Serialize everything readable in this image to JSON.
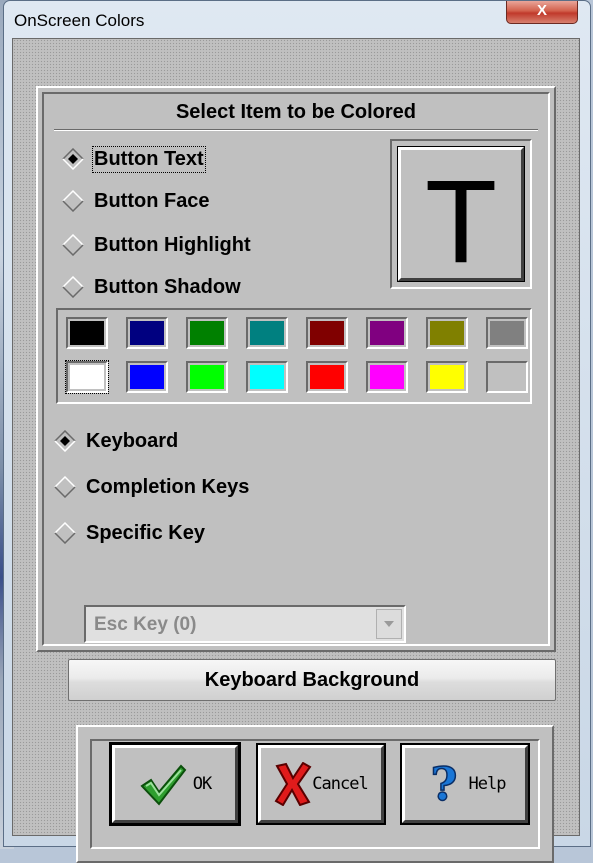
{
  "window": {
    "title": "OnScreen Colors",
    "close_glyph": "X"
  },
  "select_section": {
    "title": "Select Item to be Colored",
    "items": [
      {
        "label": "Button Text",
        "selected": true
      },
      {
        "label": "Button Face",
        "selected": false
      },
      {
        "label": "Button Highlight",
        "selected": false
      },
      {
        "label": "Button Shadow",
        "selected": false
      }
    ],
    "preview_letter": "T"
  },
  "palette": {
    "row1": [
      "#000000",
      "#000080",
      "#008000",
      "#008080",
      "#800000",
      "#800080",
      "#808000",
      "#808080"
    ],
    "row2": [
      "#ffffff",
      "#0000ff",
      "#00ff00",
      "#00ffff",
      "#ff0000",
      "#ff00ff",
      "#ffff00",
      "#c0c0c0"
    ]
  },
  "target": {
    "items": [
      {
        "label": "Keyboard",
        "selected": true
      },
      {
        "label": "Completion Keys",
        "selected": false
      },
      {
        "label": "Specific Key",
        "selected": false
      }
    ],
    "key_combo": {
      "value": "Esc Key (0)",
      "enabled": false
    }
  },
  "background_button": {
    "label": "Keyboard Background"
  },
  "buttons": {
    "ok": {
      "label": "OK",
      "icon": "checkmark-icon"
    },
    "cancel": {
      "label": "Cancel",
      "icon": "red-x-icon"
    },
    "help": {
      "label": "Help",
      "icon": "question-mark-icon"
    }
  }
}
